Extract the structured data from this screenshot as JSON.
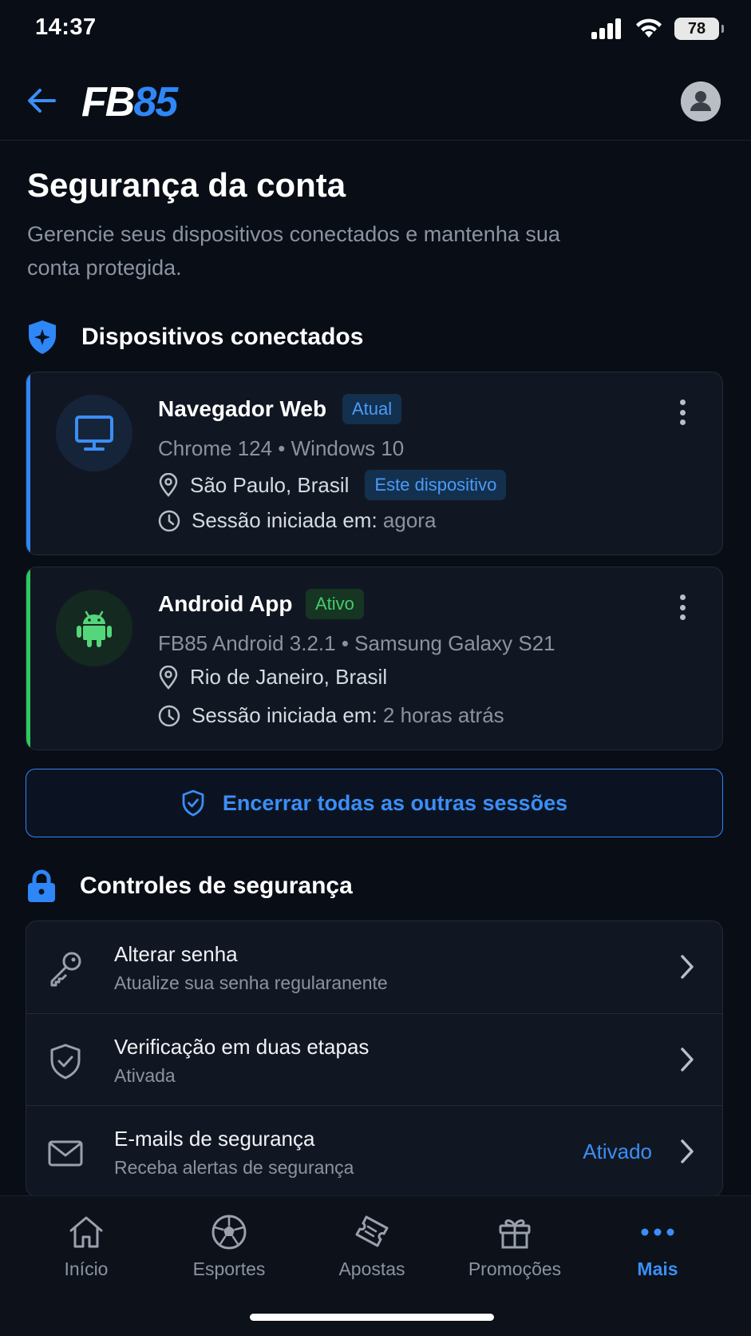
{
  "status_bar": {
    "time": "14:37",
    "battery": "78"
  },
  "header": {
    "logo_part1": "FB",
    "logo_part2": "85"
  },
  "page": {
    "title": "Segurança da conta",
    "subtitle": "Gerencie seus dispositivos conectados e mantenha sua conta protegida."
  },
  "devices_section": {
    "title": "Dispositivos conectados"
  },
  "devices": [
    {
      "name": "Navegador Web",
      "badge": "Atual",
      "details": "Chrome 124 • Windows 10",
      "location": "São Paulo, Brasil",
      "location_badge": "Este dispositivo",
      "session_label": "Sessão iniciada em:",
      "session_value": "agora"
    },
    {
      "name": "Android App",
      "badge": "Ativo",
      "details": "FB85 Android 3.2.1 • Samsung Galaxy S21",
      "location": "Rio de Janeiro, Brasil",
      "session_label": "Sessão iniciada em:",
      "session_value": "2 horas atrás"
    }
  ],
  "end_sessions_label": "Encerrar todas as outras sessões",
  "controls_section": {
    "title": "Controles de segurança"
  },
  "controls": [
    {
      "title": "Alterar senha",
      "subtitle": "Atualize sua senha regularanente"
    },
    {
      "title": "Verificação em duas etapas",
      "subtitle": "Ativada"
    },
    {
      "title": "E-mails de segurança",
      "subtitle": "Receba alertas de segurança",
      "value": "Ativado"
    }
  ],
  "bottom_nav": [
    {
      "label": "Início",
      "icon": "home-icon"
    },
    {
      "label": "Esportes",
      "icon": "soccer-ball-icon"
    },
    {
      "label": "Apostas",
      "icon": "ticket-icon"
    },
    {
      "label": "Promoções",
      "icon": "gift-icon"
    },
    {
      "label": "Mais",
      "icon": "more-dots-icon",
      "active": true
    }
  ],
  "colors": {
    "background": "#080d16",
    "accent_blue": "#2f86f6",
    "accent_green": "#2ec95c",
    "card": "#111722",
    "muted_text": "#8b93a1"
  }
}
